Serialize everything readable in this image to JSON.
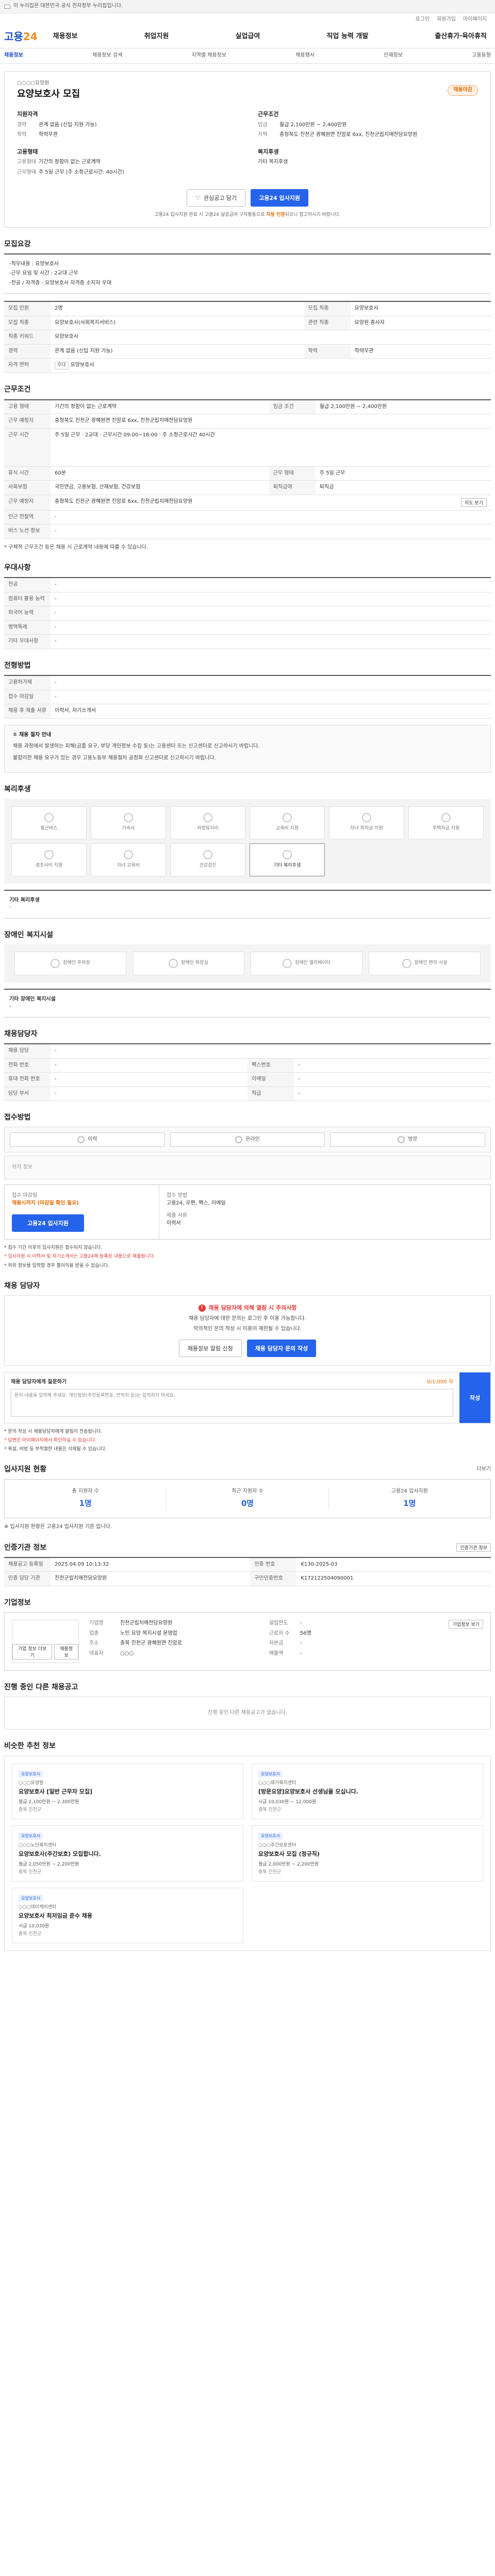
{
  "topbar": {
    "gov_text": "이 누리집은 대한민국 공식 전자정부 누리집입니다."
  },
  "util": {
    "login": "로그인",
    "join": "회원가입",
    "mypage": "마이페이지"
  },
  "gnb": {
    "logo_main": "고용",
    "logo_sub": "24",
    "menu": [
      "채용정보",
      "취업지원",
      "실업급여",
      "직업 능력 개발",
      "출산휴가·육아휴직"
    ]
  },
  "lnb": [
    "채용정보",
    "채용정보 검색",
    "지역별 채용정보",
    "채용행사",
    "인재정보",
    "고용동향"
  ],
  "header": {
    "corp": "○○○○요양원",
    "title": "요양보호사 모집",
    "badge": "채용마감"
  },
  "summary": {
    "qual_h": "지원자격",
    "qual": [
      {
        "k": "경력",
        "v": "관계 없음 (신입 지원 가능)"
      },
      {
        "k": "학력",
        "v": "학력무관"
      }
    ],
    "cond_h": "근무조건",
    "cond": [
      {
        "k": "임금",
        "v": "월급 2,100만원 ~ 2,400만원"
      },
      {
        "k": "지역",
        "v": "충청북도 진천군 광혜원면 진암로 6xx, 진천군립치매전담요양원"
      }
    ],
    "emp_h": "고용형태",
    "emp": [
      {
        "k": "고용형태",
        "v": "기간의 정함이 없는 근로계약"
      },
      {
        "k": "근무형태",
        "v": "주 5일 근무 (주 소정근로시간: 40시간)"
      }
    ],
    "welfare_h": "복지후생",
    "welfare": "기타 복지후생"
  },
  "top_buttons": {
    "scrap": "관심공고 담기",
    "apply": "고용24 입사지원"
  },
  "top_note_pre": "고용24 입사지원 완료 시 고용24 실업급여 구직활동으로 ",
  "top_note_bold": "자동 인정",
  "top_note_post": "되오니 참고하시기 바랍니다.",
  "job_detail": {
    "title": "모집요강",
    "desc": [
      "-직무내용 : 요양보호사",
      "-근무 요일 및 시간 : 2교대 근무",
      "-전공 / 자격증 : 요양보호사 자격증 소지자 우대"
    ],
    "rows": [
      {
        "k": "모집 인원",
        "v": "2명",
        "k2": "모집 직종",
        "v2": "요양보호사"
      },
      {
        "k": "모집 직종",
        "v": "요양보호사(사회복지서비스)",
        "k2": "관련 직종",
        "v2": "요양원 종사자"
      },
      {
        "k": "직종 키워드",
        "v": "요양보호사"
      },
      {
        "k": "경력",
        "v": "관계 없음 (신입 지원 가능)",
        "k2": "학력",
        "v2": "학력무관"
      },
      {
        "k": "자격 면허",
        "tag": "우대",
        "v": "요양보호사"
      }
    ]
  },
  "work_cond": {
    "title": "근무조건",
    "rows": [
      {
        "k": "고용 형태",
        "v": "기간의 정함이 없는 근로계약",
        "k2": "임금 조건",
        "v2": "월급 2,100만원 ~ 2,400만원"
      },
      {
        "k": "근무 예정지",
        "v": "충청북도 진천군 광혜원면 진암로 6xx, 진천군립치매전담요양원"
      },
      {
        "k": "근무 시간",
        "v": "주 5일 근무 · 2교대 · 근무시간 09:00~18:00 · 주 소정근로시간 40시간"
      },
      {
        "k": "휴식 시간",
        "v": "60분",
        "k2": "근무 형태",
        "v2": "주 5일 근무"
      },
      {
        "k": "사회보험",
        "v": "국민연금, 고용보험, 산재보험, 건강보험",
        "k2": "퇴직급여",
        "v2": "퇴직금"
      },
      {
        "k": "근무 예정지",
        "v": "충청북도 진천군 광혜원면 진암로 6xx, 진천군립치매전담요양원"
      },
      {
        "k": "인근 전철역",
        "v": "-"
      },
      {
        "k": "버스 노선 정보",
        "v": "-"
      }
    ],
    "map_btn": "지도 보기",
    "note": "* 구체적 근무조건 등은 채용 시 근로계약 내용에 따를 수 있습니다."
  },
  "pref": {
    "title": "우대사항",
    "rows": [
      {
        "k": "전공",
        "v": "-"
      },
      {
        "k": "컴퓨터 활용 능력",
        "v": "-"
      },
      {
        "k": "외국어 능력",
        "v": "-"
      },
      {
        "k": "병역특례",
        "v": "-"
      },
      {
        "k": "기타 우대사항",
        "v": "-"
      }
    ]
  },
  "process": {
    "title": "전형방법",
    "rows": [
      {
        "k": "고용허가제",
        "v": "-"
      },
      {
        "k": "접수 마감일",
        "v": "-"
      },
      {
        "k": "채용 후 제출 서류",
        "v": "이력서, 자기소개서"
      }
    ],
    "alert_head": "① 채용 절차 안내",
    "alert_lines": [
      "채용 과정에서 발생하는 피해(금품 요구, 부당 개인정보 수집 등)는 고용센터 또는 신고센터로 신고하시기 바랍니다.",
      "불합리한 채용 요구가 있는 경우 고용노동부 채용절차 공정화 신고센터로 신고하시기 바랍니다."
    ]
  },
  "welfare": {
    "title": "복리후생",
    "items": [
      "통근버스",
      "기숙사",
      "차량유지비",
      "교육비 지원",
      "자녀 학자금 지원",
      "주택자금 지원",
      "경조사비 지원",
      "자녀 교육비",
      "건강검진",
      "기타 복리후생"
    ],
    "other_label": "기타 복리후생",
    "other_value": "-"
  },
  "disability": {
    "title": "장애인 복지시설",
    "items": [
      "장애인 주차장",
      "장애인 화장실",
      "장애인 엘리베이터",
      "장애인 편의 시설"
    ],
    "other_label": "기타 장애인 복지시설",
    "other_value": "-"
  },
  "contact": {
    "title": "채용담당자",
    "rows": [
      {
        "k": "채용 담당",
        "v": "-"
      },
      {
        "k": "전화 번호",
        "v": "-",
        "k2": "팩스번호",
        "v2": "-"
      },
      {
        "k": "휴대 전화 번호",
        "v": "-",
        "k2": "이메일",
        "v2": "-"
      },
      {
        "k": "담당 부서",
        "v": "-",
        "k2": "직급",
        "v2": "-"
      }
    ]
  },
  "apply": {
    "title": "접수방법",
    "tabs": [
      "이력",
      "온라인",
      "방문"
    ],
    "map_text": "위치 정보",
    "deadline_lbl": "접수 마감일",
    "deadline_val": "채용시까지 (마감일 확인 필요)",
    "method_lbl": "접수 방법",
    "method_val": "고용24, 우편, 팩스, 이메일",
    "docs_lbl": "제출 서류",
    "docs_val": "이력서",
    "apply_btn": "고용24 입사지원",
    "bullets": [
      "* 접수 기간 이후의 입사지원은 접수되지 않습니다.",
      "* 입사지원 시 이력서 및 자기소개서는 고용24에 등록된 내용으로 제출됩니다.",
      "* 허위 정보를 입력할 경우 불이익을 받을 수 있습니다."
    ]
  },
  "inquiry": {
    "title": "채용 담당자",
    "warn": "채용 담당자에 의해 열람 시 주의사항",
    "line1": "채용 담당자에 대한 문의는 로그인 후 이용 가능합니다.",
    "line2": "악의적인 문의 작성 시 이용이 제한될 수 있습니다.",
    "btn1": "채용정보 알림 신청",
    "btn2": "채용 담당자 문의 작성",
    "q_label": "채용 담당자에게 질문하기",
    "q_limit": "0/1,000 자",
    "q_placeholder": "문의 내용을 입력해 주세요. 개인정보(주민등록번호, 연락처 등)는 입력하지 마세요.",
    "q_submit": "작성",
    "q_notes": [
      "* 문의 작성 시 채용담당자에게 알림이 전송됩니다.",
      "* 답변은 마이페이지에서 확인하실 수 있습니다.",
      "* 욕설, 비방 등 부적절한 내용은 삭제될 수 있습니다."
    ]
  },
  "stats": {
    "title": "입사지원 현황",
    "more": "더보기",
    "items": [
      {
        "lbl": "총 지원자 수",
        "num": "1명"
      },
      {
        "lbl": "최근 지원자 수",
        "num": "0명"
      },
      {
        "lbl": "고용24 입사지원",
        "num": "1명"
      }
    ],
    "note": "※ 입사지원 현황은 고용24 입사지원 기준 입니다."
  },
  "info": {
    "title": "인증기관 정보",
    "btn": "인증기관 정보",
    "rows": [
      {
        "k": "채용공고 등록일",
        "v": "2025.04.09 10:13:32",
        "k2": "인증 번호",
        "v2": "K130-2025-03"
      },
      {
        "k": "인증 담당 기관",
        "v": "진천군립치매전담요양원",
        "k2": "구인인증번호",
        "v2": "K172122504090001"
      }
    ]
  },
  "company": {
    "title": "기업정보",
    "btn_detail": "기업정보 보기",
    "btn_more": "기업 정보 더보기",
    "btn_jobs": "채용정보",
    "cols": [
      [
        {
          "k": "기업명",
          "v": "진천군립치매전담요양원"
        },
        {
          "k": "업종",
          "v": "노인 요양 복지시설 운영업"
        },
        {
          "k": "주소",
          "v": "충북 진천군 광혜원면 진암로"
        },
        {
          "k": "대표자",
          "v": "○○○"
        }
      ],
      [
        {
          "k": "설립연도",
          "v": "-"
        },
        {
          "k": "근로자 수",
          "v": "56명"
        },
        {
          "k": "자본금",
          "v": "-"
        },
        {
          "k": "매출액",
          "v": "-"
        }
      ]
    ]
  },
  "company_jobs": {
    "title": "진행 중인 다른 채용공고",
    "empty": "진행 중인 다른 채용공고가 없습니다."
  },
  "recommend": {
    "title": "비슷한 추천 정보",
    "cards": [
      {
        "tags": [
          "요양보호사"
        ],
        "corp": "○○○요양원",
        "title": "요양보호사 [일반 근무자 모집]",
        "meta": "월급 2,100만원 ~ 2,300만원",
        "loc": "충북 진천군"
      },
      {
        "tags": [
          "요양보호사"
        ],
        "corp": "○○○재가복지센터",
        "title": "[방문요양]요양보호사 선생님을 모십니다.",
        "meta": "시급 10,030원 ~ 12,000원",
        "loc": "충북 진천군"
      },
      {
        "tags": [
          "요양보호사"
        ],
        "corp": "○○○노인복지센터",
        "title": "요양보호사(주간보호) 모집합니다.",
        "meta": "월급 2,050만원 ~ 2,200만원",
        "loc": "충북 진천군"
      },
      {
        "tags": [
          "요양보호사"
        ],
        "corp": "○○○주간보호센터",
        "title": "요양보호사 모집 (정규직)",
        "meta": "월급 2,000만원 ~ 2,200만원",
        "loc": "충북 진천군"
      },
      {
        "tags": [
          "요양보호사"
        ],
        "corp": "○○○데이케어센터",
        "title": "요양보호사 최저임금 준수 채용",
        "meta": "시급 10,030원",
        "loc": "충북 진천군"
      }
    ]
  }
}
